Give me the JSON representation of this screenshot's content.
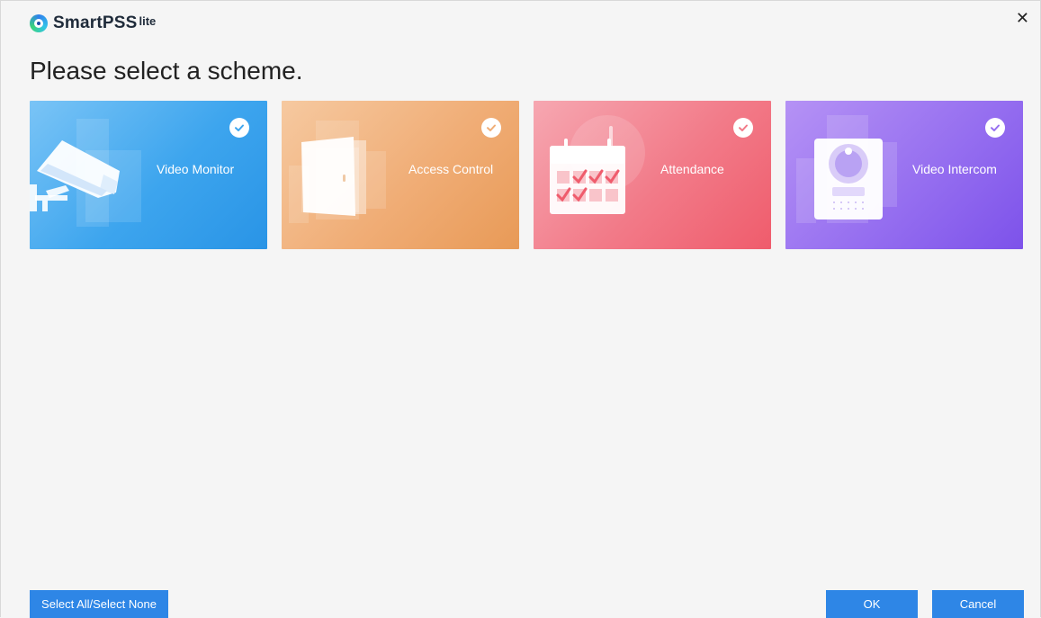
{
  "app": {
    "logo_text": "SmartPSS",
    "logo_sup": "lite",
    "close_glyph": "✕"
  },
  "page": {
    "title": "Please select a scheme."
  },
  "schemes": [
    {
      "label": "Video Monitor",
      "selected": true,
      "icon": "camera-icon",
      "color": "#3da5ee"
    },
    {
      "label": "Access Control",
      "selected": true,
      "icon": "door-icon",
      "color": "#f0ad76"
    },
    {
      "label": "Attendance",
      "selected": true,
      "icon": "calendar-icon",
      "color": "#f27a88"
    },
    {
      "label": "Video Intercom",
      "selected": true,
      "icon": "intercom-icon",
      "color": "#966ff0"
    }
  ],
  "footer": {
    "select_all_label": "Select All/Select None",
    "ok_label": "OK",
    "cancel_label": "Cancel"
  },
  "colors": {
    "button_blue": "#2e86e6",
    "background": "#f5f5f5"
  }
}
